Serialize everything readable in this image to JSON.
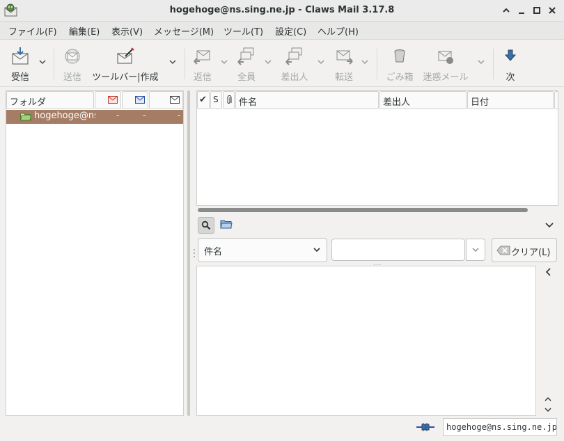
{
  "window": {
    "title": "hogehoge@ns.sing.ne.jp - Claws Mail 3.17.8"
  },
  "menu": {
    "items": [
      "ファイル(F)",
      "編集(E)",
      "表示(V)",
      "メッセージ(M)",
      "ツール(T)",
      "設定(C)",
      "ヘルプ(H)"
    ]
  },
  "toolbar": {
    "receive": "受信",
    "send": "送信",
    "compose": "ツールバー|作成",
    "reply": "返信",
    "reply_all": "全員",
    "reply_sender": "差出人",
    "forward": "転送",
    "trash": "ごみ箱",
    "spam": "迷惑メール",
    "next": "次"
  },
  "folder_pane": {
    "column_header": "フォルダ",
    "rows": [
      {
        "name": "hogehoge@ns.sing.ne.jp",
        "new": "-",
        "unread": "-",
        "total": "-"
      }
    ]
  },
  "message_list": {
    "columns": {
      "mark": "✔",
      "status": "S",
      "attach": "",
      "subject": "件名",
      "from": "差出人",
      "date": "日付"
    }
  },
  "quick_search": {
    "type_selected": "件名",
    "input_value": "",
    "clear_label": "クリア(L)"
  },
  "statusbar": {
    "account": "hogehoge@ns.sing.ne.jp"
  }
}
